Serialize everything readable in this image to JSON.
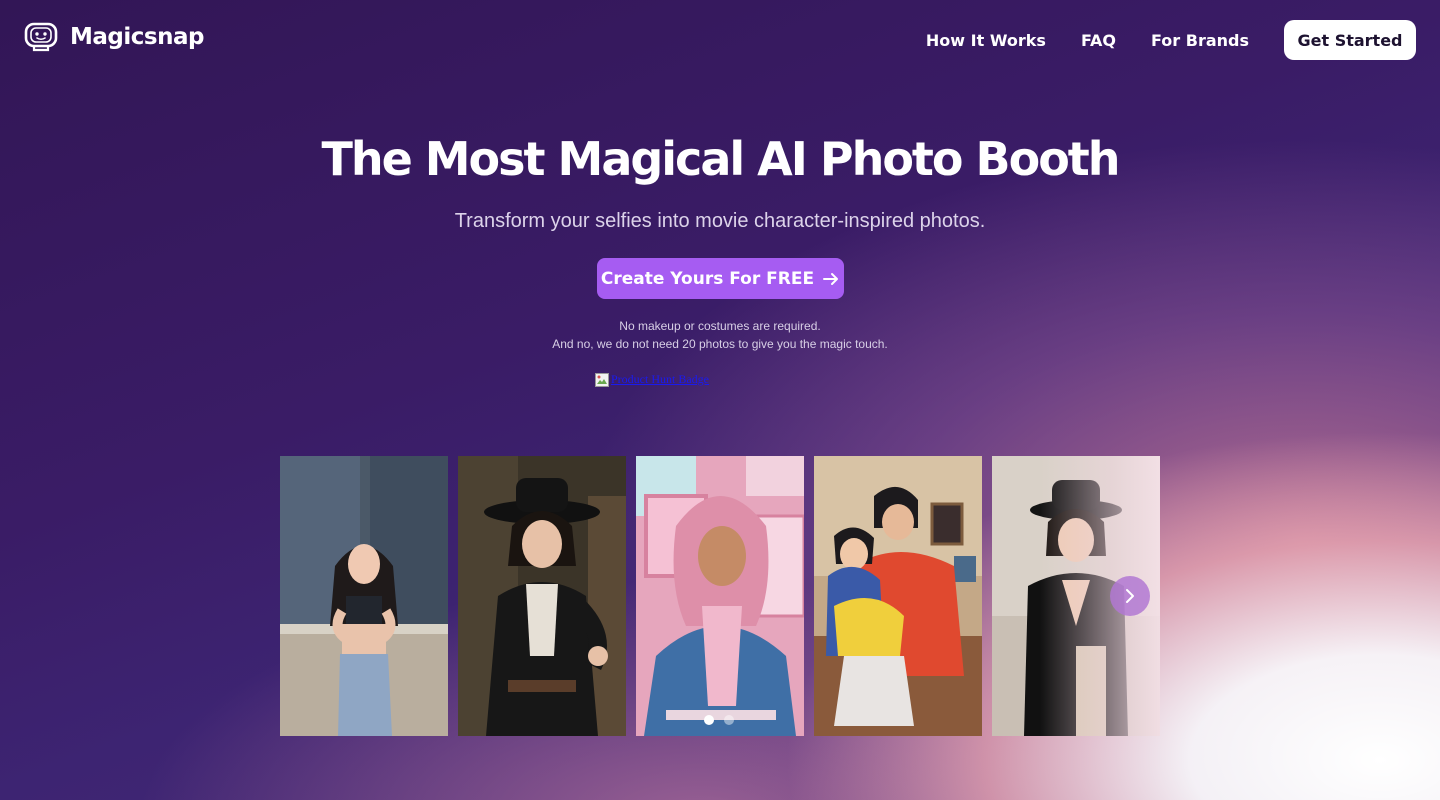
{
  "brand": {
    "name": "Magicsnap",
    "logo_icon": "face-frame-icon"
  },
  "nav": {
    "links": [
      "How It Works",
      "FAQ",
      "For Brands"
    ],
    "cta_label": "Get Started"
  },
  "hero": {
    "title": "The Most Magical AI Photo Booth",
    "subtitle": "Transform your selfies into movie character-inspired photos.",
    "cta_label": "Create Yours For FREE",
    "cta_icon": "arrow-right-icon",
    "note_line_1": "No makeup or costumes are required.",
    "note_line_2": "And no, we do not need 20 photos to give you the magic touch.",
    "badge_alt": "Product Hunt Badge"
  },
  "carousel": {
    "slide_count": 5,
    "active_dot": 0,
    "dot_count": 2,
    "next_icon": "chevron-right-icon"
  },
  "colors": {
    "background_dark": "#321656",
    "accent_purple": "#a65cf2",
    "subtitle_text": "#dcd3ea",
    "button_white": "#ffffff"
  }
}
